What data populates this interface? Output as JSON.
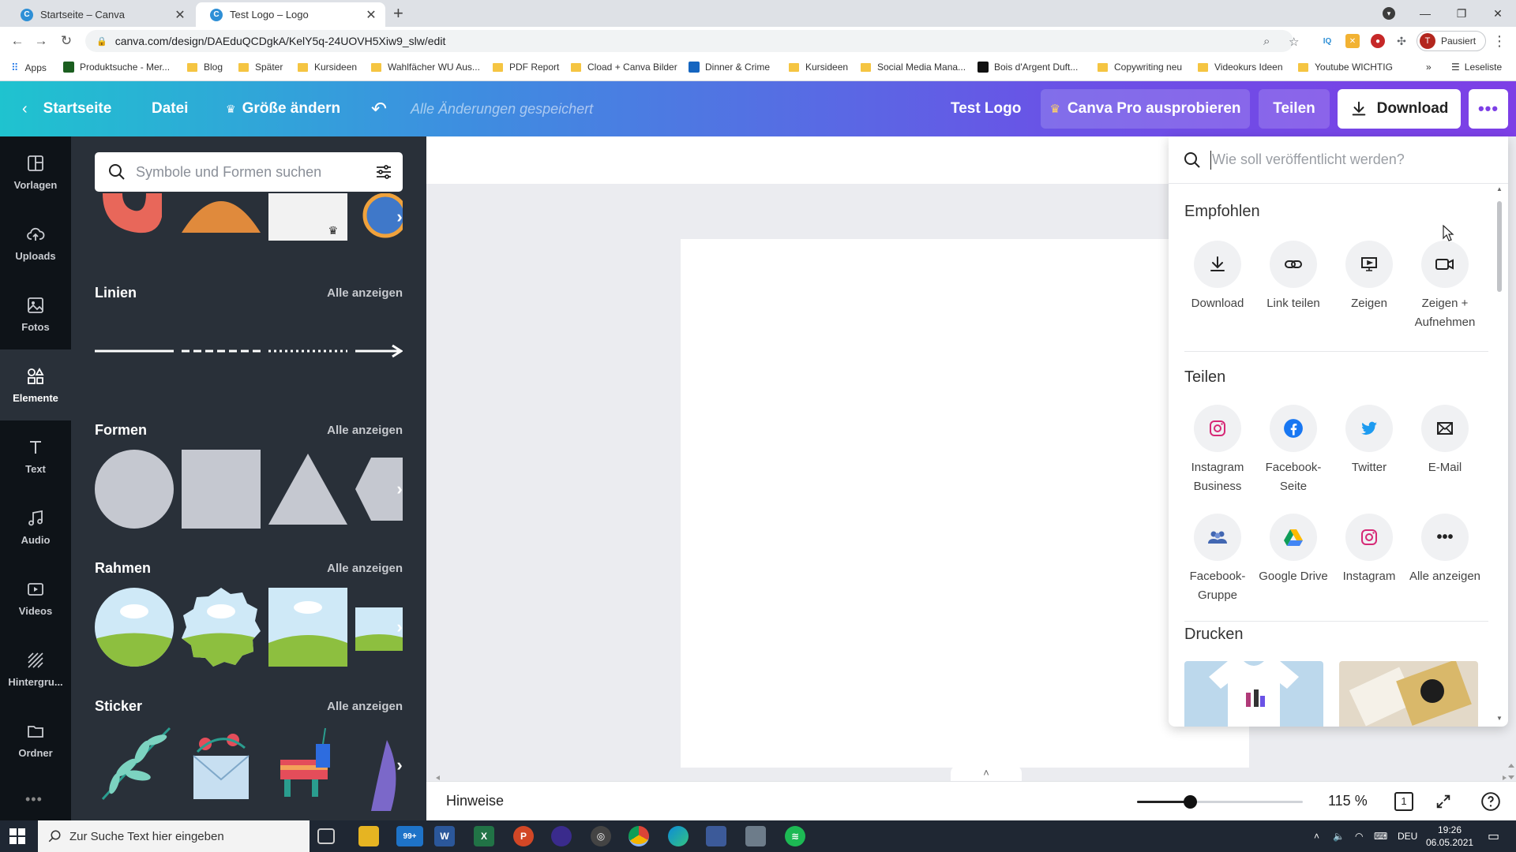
{
  "browser": {
    "tabs": [
      {
        "title": "Startseite – Canva",
        "favicon": "C"
      },
      {
        "title": "Test Logo – Logo",
        "favicon": "C"
      }
    ],
    "url": "canva.com/design/DAEduQCDgkA/KelY5q-24UOVH5Xiw9_slw/edit",
    "profile_initial": "T",
    "profile_status": "Pausiert",
    "bookmarks": [
      "Apps",
      "Produktsuche - Mer...",
      "Blog",
      "Später",
      "Kursideen",
      "Wahlfächer WU Aus...",
      "PDF Report",
      "Cload + Canva Bilder",
      "Dinner & Crime",
      "Kursideen",
      "Social Media Mana...",
      "Bois d'Argent Duft...",
      "Copywriting neu",
      "Videokurs Ideen",
      "Youtube WICHTIG"
    ],
    "reading_list": "Leseliste",
    "overflow": "»"
  },
  "header": {
    "home": "Startseite",
    "file": "Datei",
    "resize": "Größe ändern",
    "saved": "Alle Änderungen gespeichert",
    "doc_title": "Test Logo",
    "pro": "Canva Pro ausprobieren",
    "share": "Teilen",
    "download": "Download"
  },
  "rail": [
    {
      "label": "Vorlagen",
      "icon": "templates-icon"
    },
    {
      "label": "Uploads",
      "icon": "upload-cloud-icon"
    },
    {
      "label": "Fotos",
      "icon": "photo-icon"
    },
    {
      "label": "Elemente",
      "icon": "shapes-icon"
    },
    {
      "label": "Text",
      "icon": "text-icon"
    },
    {
      "label": "Audio",
      "icon": "music-note-icon"
    },
    {
      "label": "Videos",
      "icon": "video-icon"
    },
    {
      "label": "Hintergru...",
      "icon": "background-icon"
    },
    {
      "label": "Ordner",
      "icon": "folder-icon"
    }
  ],
  "elements_panel": {
    "search_placeholder": "Symbole und Formen suchen",
    "sections": [
      {
        "title": "Linien",
        "link": "Alle anzeigen"
      },
      {
        "title": "Formen",
        "link": "Alle anzeigen"
      },
      {
        "title": "Rahmen",
        "link": "Alle anzeigen"
      },
      {
        "title": "Sticker",
        "link": "Alle anzeigen"
      }
    ]
  },
  "share_panel": {
    "search_placeholder": "Wie soll veröffentlicht werden?",
    "recommended_title": "Empfohlen",
    "recommended": [
      {
        "label": "Download",
        "icon": "download-icon"
      },
      {
        "label": "Link teilen",
        "icon": "link-icon"
      },
      {
        "label": "Zeigen",
        "icon": "present-icon"
      },
      {
        "label": "Zeigen + Aufnehmen",
        "icon": "record-icon"
      }
    ],
    "share_title": "Teilen",
    "share": [
      {
        "label": "Instagram Business",
        "icon": "instagram-icon"
      },
      {
        "label": "Facebook-Seite",
        "icon": "facebook-icon"
      },
      {
        "label": "Twitter",
        "icon": "twitter-icon"
      },
      {
        "label": "E-Mail",
        "icon": "email-icon"
      },
      {
        "label": "Facebook-Gruppe",
        "icon": "facebook-group-icon"
      },
      {
        "label": "Google Drive",
        "icon": "google-drive-icon"
      },
      {
        "label": "Instagram",
        "icon": "instagram-icon"
      },
      {
        "label": "Alle anzeigen",
        "icon": "more-horizontal-icon"
      }
    ],
    "print_title": "Drucken"
  },
  "footer": {
    "notes": "Hinweise",
    "zoom": "115 %",
    "zoom_level": 0.32,
    "page_count": "1"
  },
  "taskbar": {
    "search_placeholder": "Zur Suche Text hier eingeben",
    "mail_badge": "99+",
    "language": "DEU",
    "time": "19:26",
    "date": "06.05.2021"
  },
  "colors": {
    "header_gradient_start": "#1fc3cf",
    "header_gradient_end": "#7d3fe6",
    "panel_bg": "#293039",
    "rail_bg": "#0e1318"
  }
}
